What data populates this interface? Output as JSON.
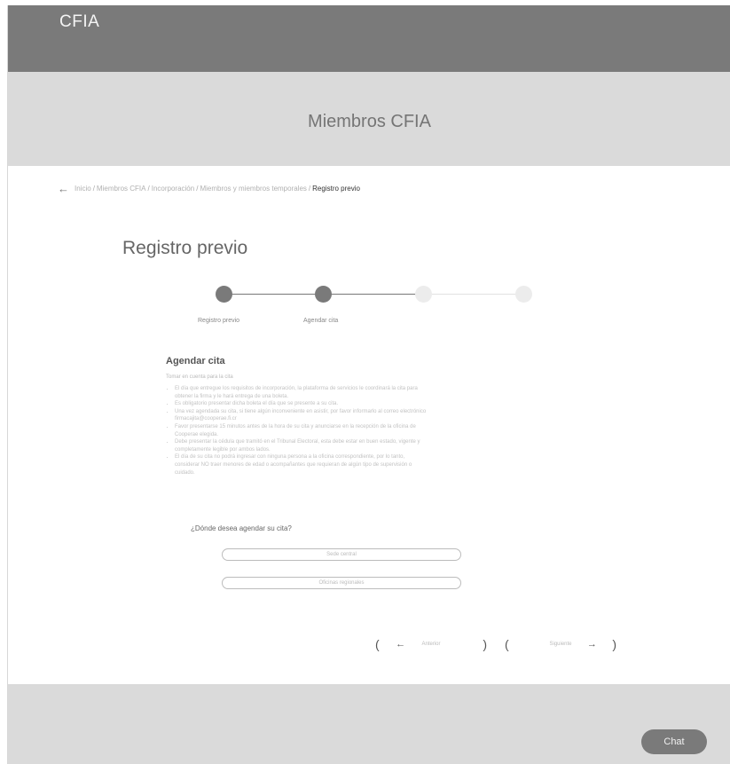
{
  "header": {
    "logo": "CFIA"
  },
  "hero": {
    "title": "Miembros CFIA"
  },
  "breadcrumb": {
    "back_icon": "arrow-left-icon",
    "items": [
      "Inicio",
      "Miembros CFIA",
      "Incorporación",
      "Miembros y miembros temporales"
    ],
    "current": "Registro previo"
  },
  "page": {
    "title": "Registro previo"
  },
  "stepper": {
    "steps": [
      {
        "label": "Registro previo",
        "state": "completed"
      },
      {
        "label": "Agendar cita",
        "state": "current"
      },
      {
        "label": "",
        "state": "pending"
      },
      {
        "label": "",
        "state": "pending"
      }
    ]
  },
  "appointment": {
    "title": "Agendar cita",
    "intro": "Tomar en cuenta para la cita",
    "notes": [
      "El día que entregue los requisitos de incorporación, la plataforma de servicios le coordinará la cita para obtener la firma y le hará entrega de una boleta.",
      "Es obligatorio presentar dicha boleta el día que se presente a su cita.",
      "Una vez agendada su cita, si tiene algún inconveniente en asistir, por favor informarlo al correo electrónico firmacajita@cooperae.fi.cr",
      "Favor presentarse 15 minutos antes de la hora de su cita y anunciarse en la recepción de la oficina de Cooperae elegida.",
      "Debe presentar la cédula que tramitó en el Tribunal Electoral, esta debe estar en buen estado, vigente y completamente legible por ambos lados.",
      "El día de su cita no podrá ingresar con ninguna persona a la oficina correspondiente, por lo tanto, considerar NO traer menores de edad o acompañantes que requieran de algún tipo de supervisión o cuidado."
    ],
    "question": "¿Dónde desea agendar su cita?",
    "options": [
      "Sede central",
      "Oficinas regionales"
    ]
  },
  "navigation": {
    "prev_label": "Anterior",
    "next_label": "Siguiente",
    "prev_icon": "arrow-left-icon",
    "next_icon": "arrow-right-icon"
  },
  "chat": {
    "label": "Chat"
  },
  "colors": {
    "header_bg": "#7a7a7a",
    "hero_bg": "#dadada",
    "active_step": "#7a7a7a",
    "pending_step": "#ececec"
  }
}
